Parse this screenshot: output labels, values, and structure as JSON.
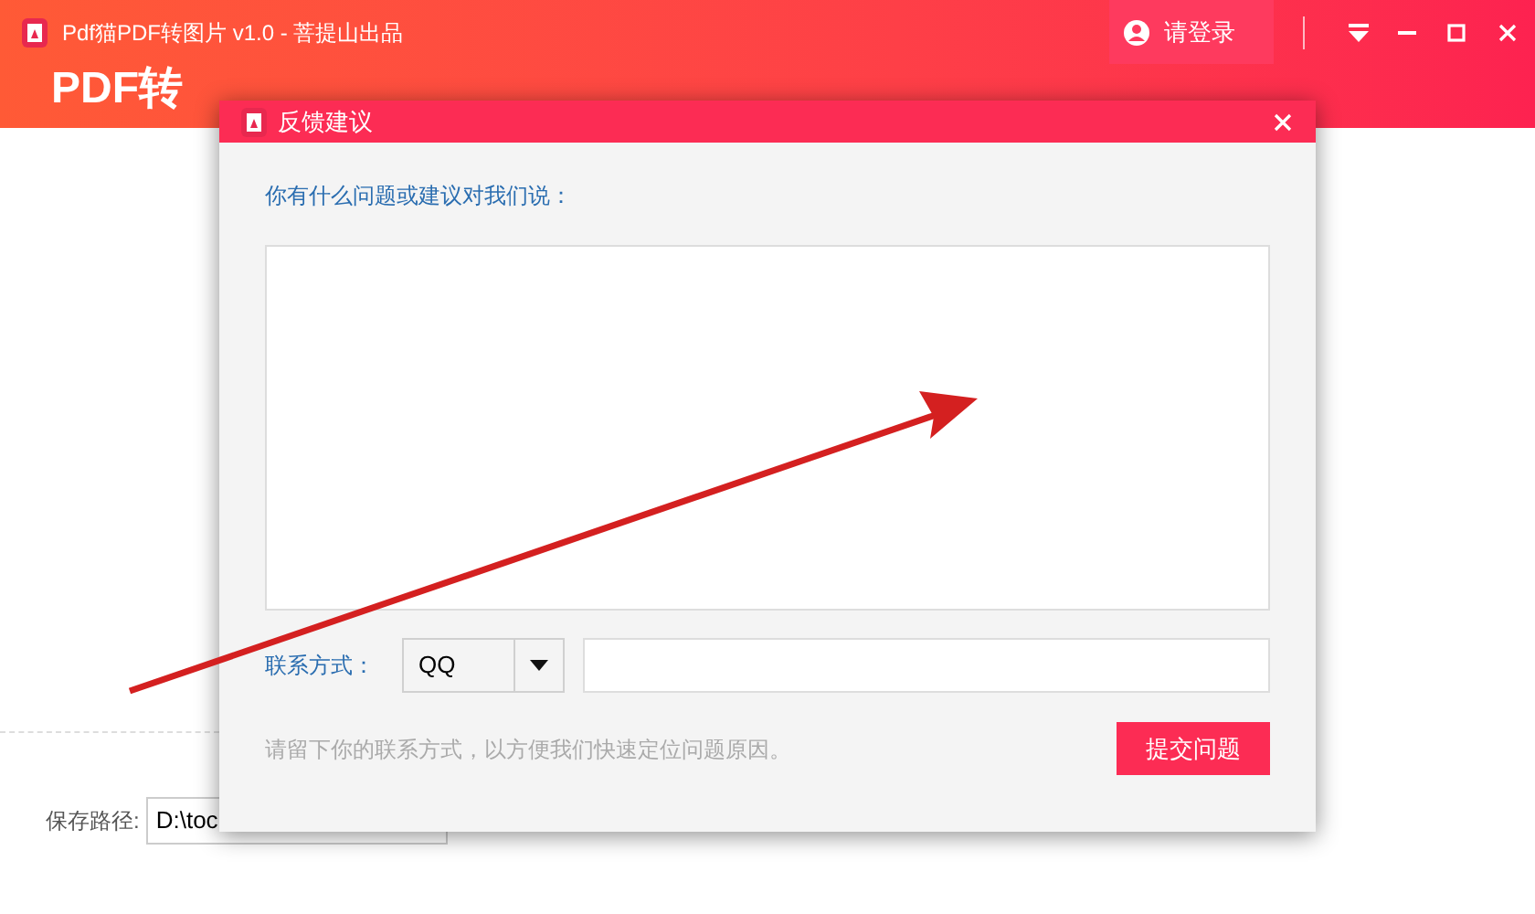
{
  "window": {
    "title": "Pdf猫PDF转图片 v1.0 - 菩提山出品",
    "login": "请登录",
    "banner": "PDF转"
  },
  "save_path": {
    "label": "保存路径:",
    "value": "D:\\toc"
  },
  "dialog": {
    "title": "反馈建议",
    "prompt": "你有什么问题或建议对我们说：",
    "contact_label": "联系方式：",
    "contact_type": "QQ",
    "hint": "请留下你的联系方式，以方便我们快速定位问题原因。",
    "submit": "提交问题"
  }
}
